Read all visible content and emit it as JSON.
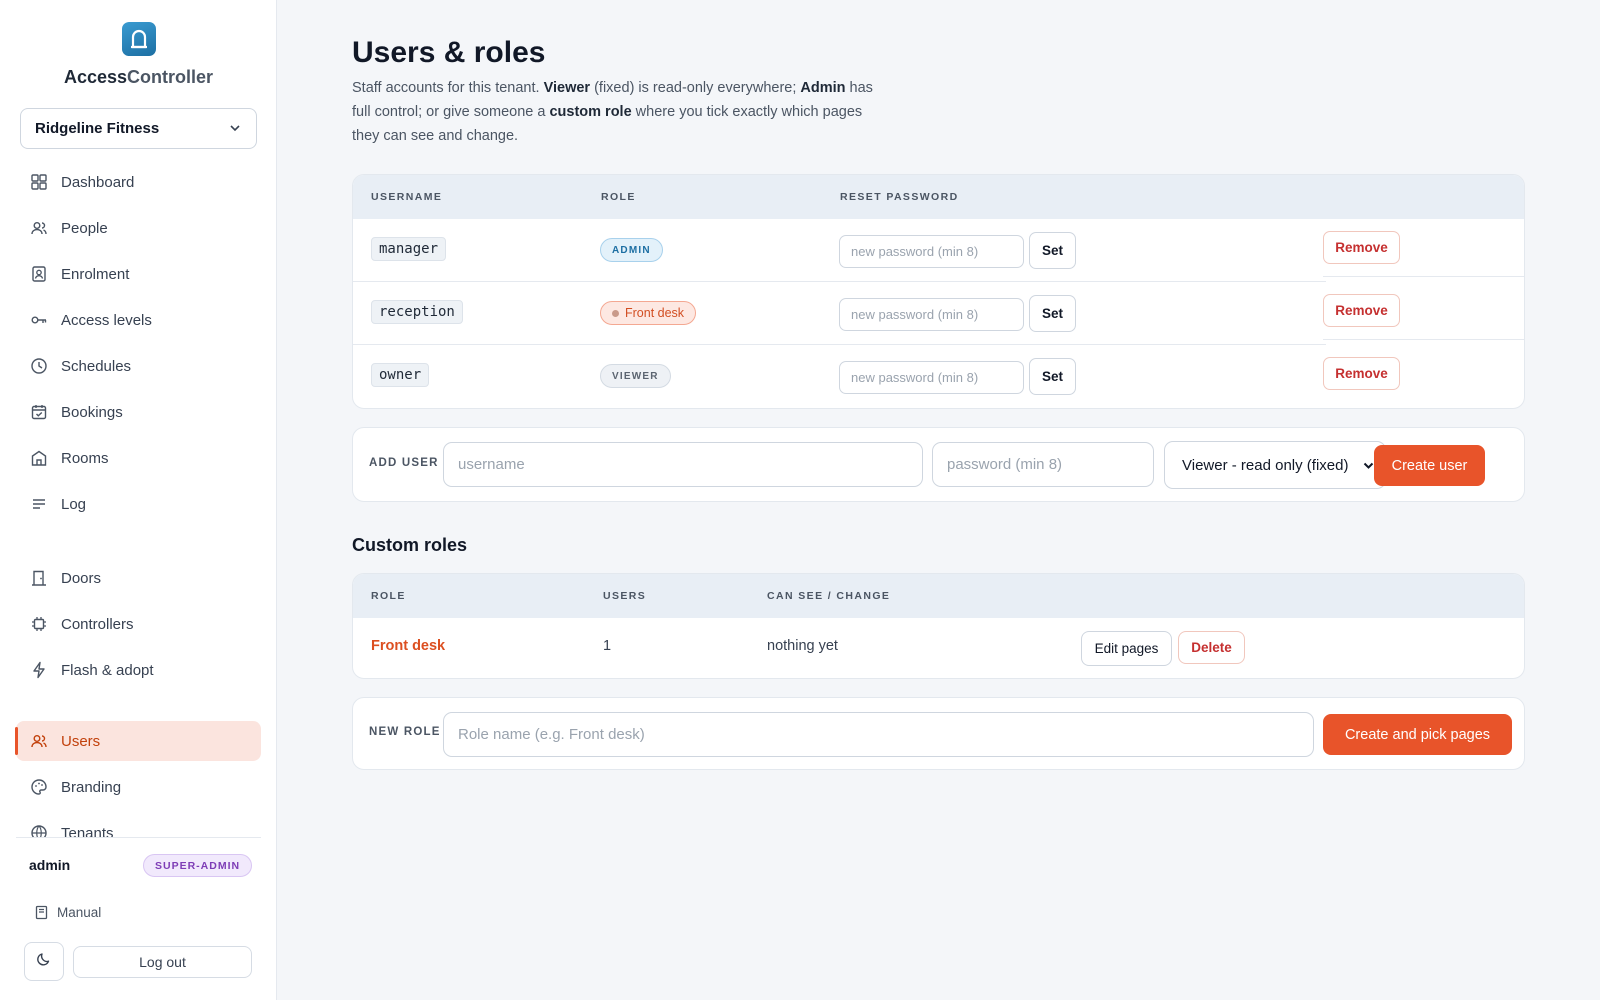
{
  "brand": {
    "name_part1": "Access",
    "name_part2": "Controller",
    "logo_icon": "door-lock-icon"
  },
  "tenant_select": {
    "value": "Ridgeline Fitness"
  },
  "nav": {
    "dashboard": "Dashboard",
    "people": "People",
    "enrolment": "Enrolment",
    "access_levels": "Access levels",
    "schedules": "Schedules",
    "bookings": "Bookings",
    "rooms": "Rooms",
    "log": "Log",
    "doors": "Doors",
    "controllers": "Controllers",
    "flash_adopt": "Flash & adopt",
    "users": "Users",
    "branding": "Branding",
    "tenants": "Tenants"
  },
  "footer": {
    "user": "admin",
    "badge": "SUPER-ADMIN",
    "manual": "Manual",
    "logout": "Log out"
  },
  "page": {
    "title": "Users & roles",
    "desc": {
      "t1": "Staff accounts for this tenant. ",
      "b1": "Viewer",
      "t2": " (fixed) is read-only everywhere; ",
      "b2": "Admin",
      "t3": " has full control; or give someone a ",
      "b3": "custom role",
      "t4": " where you tick exactly which pages they can see and change."
    }
  },
  "users_table": {
    "headers": {
      "username": "USERNAME",
      "role": "ROLE",
      "reset_password": "RESET PASSWORD"
    },
    "rows": [
      {
        "username": "manager",
        "role": "ADMIN",
        "pw_placeholder": "new password (min 8)",
        "set": "Set",
        "remove": "Remove"
      },
      {
        "username": "reception",
        "role": "Front desk",
        "pw_placeholder": "new password (min 8)",
        "set": "Set",
        "remove": "Remove"
      },
      {
        "username": "owner",
        "role": "VIEWER",
        "pw_placeholder": "new password (min 8)",
        "set": "Set",
        "remove": "Remove"
      }
    ]
  },
  "add_user": {
    "label": "ADD USER",
    "username_placeholder": "username",
    "password_placeholder": "password (min 8)",
    "role_value": "Viewer - read only (fixed)",
    "create": "Create user"
  },
  "custom_roles": {
    "title": "Custom roles",
    "headers": {
      "role": "ROLE",
      "users": "USERS",
      "can": "CAN SEE / CHANGE"
    },
    "rows": [
      {
        "name": "Front desk",
        "users": "1",
        "can": "nothing yet",
        "edit": "Edit pages",
        "delete": "Delete"
      }
    ]
  },
  "new_role": {
    "label": "NEW ROLE",
    "placeholder": "Role name (e.g. Front desk)",
    "create": "Create and pick pages"
  },
  "colors": {
    "accent": "#e8542a",
    "active_bg": "#fbe4de",
    "danger": "#c53030"
  }
}
